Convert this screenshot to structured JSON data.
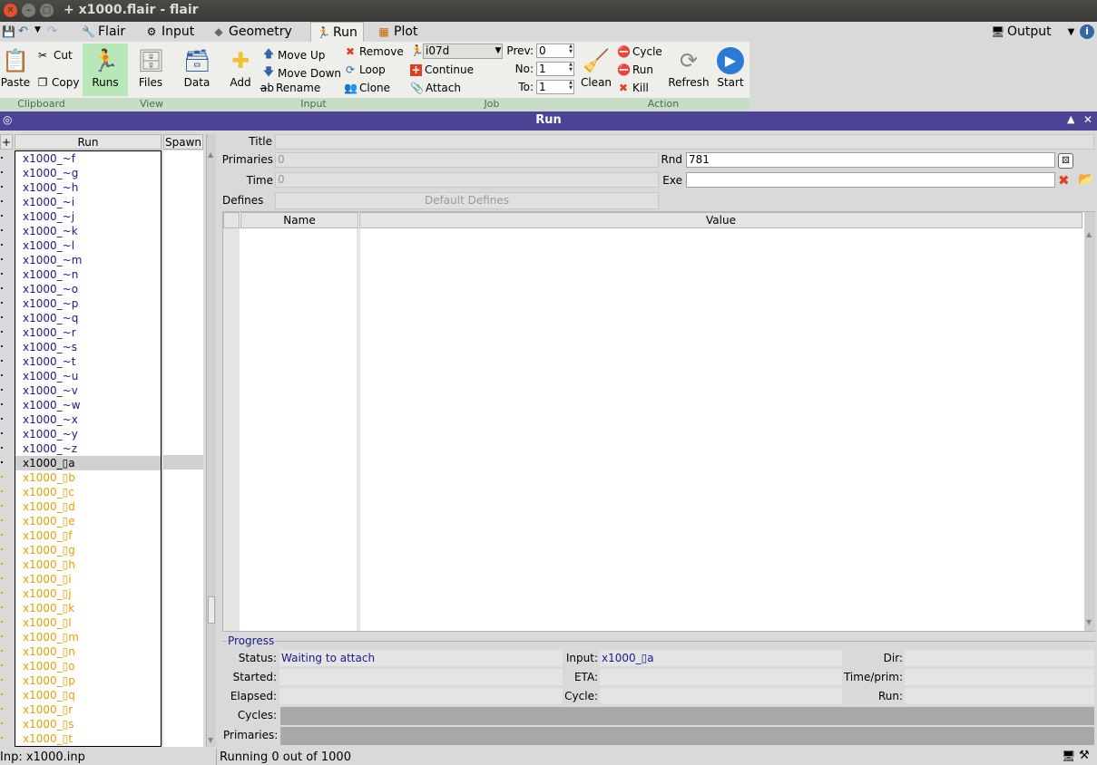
{
  "window": {
    "title": "+ x1000.flair - flair"
  },
  "menu": {
    "tabs": [
      {
        "label": "Flair",
        "icon": "flair-icon"
      },
      {
        "label": "Input",
        "icon": "input-icon"
      },
      {
        "label": "Geometry",
        "icon": "geometry-icon"
      },
      {
        "label": "Run",
        "icon": "run-icon"
      },
      {
        "label": "Plot",
        "icon": "plot-icon"
      }
    ],
    "output_label": "Output"
  },
  "ribbon": {
    "clipboard": {
      "label": "Clipboard",
      "paste": "Paste",
      "cut": "Cut",
      "copy": "Copy"
    },
    "view": {
      "label": "View",
      "runs": "Runs",
      "files": "Files",
      "data": "Data"
    },
    "input": {
      "label": "Input",
      "add": "Add",
      "move_up": "Move Up",
      "move_down": "Move Down",
      "rename": "Rename",
      "remove": "Remove",
      "loop": "Loop",
      "clone": "Clone"
    },
    "job": {
      "label": "Job",
      "host": "i07d",
      "continue": "Continue",
      "attach": "Attach",
      "prev_label": "Prev:",
      "prev_value": "0",
      "no_label": "No:",
      "no_value": "1",
      "to_label": "To:",
      "to_value": "1"
    },
    "action": {
      "label": "Action",
      "clean": "Clean",
      "cycle": "Cycle",
      "run": "Run",
      "kill": "Kill",
      "refresh": "Refresh",
      "start": "Start"
    }
  },
  "panel": {
    "title": "Run"
  },
  "runlist": {
    "header_plus": "+",
    "header_run": "Run",
    "header_spawn": "Spawn",
    "items_blue": [
      "x1000_~f",
      "x1000_~g",
      "x1000_~h",
      "x1000_~i",
      "x1000_~j",
      "x1000_~k",
      "x1000_~l",
      "x1000_~m",
      "x1000_~n",
      "x1000_~o",
      "x1000_~p",
      "x1000_~q",
      "x1000_~r",
      "x1000_~s",
      "x1000_~t",
      "x1000_~u",
      "x1000_~v",
      "x1000_~w",
      "x1000_~x",
      "x1000_~y",
      "x1000_~z"
    ],
    "selected": "x1000_▯a",
    "items_orange": [
      "x1000_▯b",
      "x1000_▯c",
      "x1000_▯d",
      "x1000_▯e",
      "x1000_▯f",
      "x1000_▯g",
      "x1000_▯h",
      "x1000_▯i",
      "x1000_▯j",
      "x1000_▯k",
      "x1000_▯l",
      "x1000_▯m",
      "x1000_▯n",
      "x1000_▯o",
      "x1000_▯p",
      "x1000_▯q",
      "x1000_▯r",
      "x1000_▯s",
      "x1000_▯t"
    ]
  },
  "form": {
    "title_label": "Title",
    "primaries_label": "Primaries",
    "primaries_value": "0",
    "rnd_label": "Rnd",
    "rnd_value": "781",
    "time_label": "Time",
    "time_value": "0",
    "exe_label": "Exe",
    "exe_value": "",
    "defines_label": "Defines",
    "default_defines": "Default Defines"
  },
  "defines_table": {
    "name_header": "Name",
    "value_header": "Value"
  },
  "progress": {
    "title": "Progress",
    "status_label": "Status:",
    "status_value": "Waiting to attach",
    "input_label": "Input:",
    "input_value": "x1000_▯a",
    "dir_label": "Dir:",
    "started_label": "Started:",
    "eta_label": "ETA:",
    "timeprim_label": "Time/prim:",
    "elapsed_label": "Elapsed:",
    "cycle_label": "Cycle:",
    "run_label": "Run:",
    "cycles_label": "Cycles:",
    "primaries_label": "Primaries:"
  },
  "statusbar": {
    "left": "Inp: x1000.inp",
    "right": "Running 0 out of 1000"
  },
  "colors": {
    "blue_item": "#1a1a8c",
    "orange_item": "#e8a000",
    "panel_bar": "#4d4396",
    "group_label": "#c8ddc8"
  }
}
